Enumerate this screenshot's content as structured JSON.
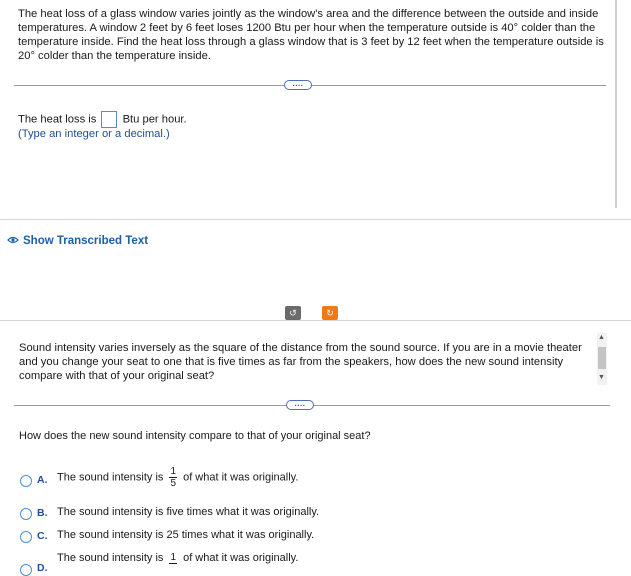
{
  "problem1": {
    "text_l1": "The heat loss of a glass window varies jointly as the window's area and the difference between the outside and inside",
    "text_l2": "temperatures. A window 2 feet by 6 feet loses 1200 Btu per hour when the temperature outside is 40° colder than the",
    "text_l3": "temperature inside. Find the heat loss through a glass window that is 3 feet by 12 feet when the temperature outside is",
    "text_l4": "20° colder than the temperature inside.",
    "more_label": "....",
    "answer_prefix": "The heat loss is",
    "answer_suffix": "Btu per hour.",
    "answer_value": "",
    "hint": "(Type an integer or a decimal.)"
  },
  "show_transcribed": "Show Transcribed Text",
  "controls": {
    "rotate_icon": "↺",
    "reset_icon": "↻"
  },
  "problem2": {
    "text_l1": "Sound intensity varies inversely as the square of the distance from the sound source. If you are in a movie theater",
    "text_l2": "and you change your seat to one that is five times as far from the speakers, how does the new sound intensity",
    "text_l3": "compare with that of your original seat?",
    "more_label": "....",
    "question": "How does the new sound intensity compare to that of your original seat?",
    "options": [
      {
        "letter": "A.",
        "pre": "The sound intensity is",
        "num": "1",
        "den": "5",
        "post": "of what it was originally."
      },
      {
        "letter": "B.",
        "text": "The sound intensity is five times what it was originally."
      },
      {
        "letter": "C.",
        "text": "The sound intensity is 25 times what it was originally."
      },
      {
        "letter": "D.",
        "pre": "The sound intensity is",
        "num": "1",
        "den": "",
        "post": "of what it was originally."
      }
    ]
  },
  "colors": {
    "accent": "#1f4e9c",
    "reset_button": "#f07a1a",
    "rotate_button": "#6b6b6b"
  },
  "icons": [
    "eye-icon",
    "rotate-icon",
    "reset-icon",
    "scroll-up-icon",
    "scroll-down-icon"
  ]
}
